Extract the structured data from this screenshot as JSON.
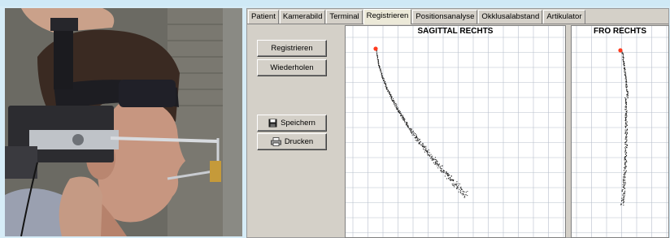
{
  "tabs": [
    {
      "label": "Patient",
      "active": false
    },
    {
      "label": "Kamerabild",
      "active": false
    },
    {
      "label": "Terminal",
      "active": false
    },
    {
      "label": "Registrieren",
      "active": true
    },
    {
      "label": "Positionsanalyse",
      "active": false
    },
    {
      "label": "Okklusalabstand",
      "active": false
    },
    {
      "label": "Artikulator",
      "active": false
    }
  ],
  "buttons": {
    "register": "Registrieren",
    "repeat": "Wiederholen",
    "save": "Speichern",
    "print": "Drucken",
    "save_icon": "floppy-disk-icon",
    "print_icon": "printer-icon"
  },
  "plots": {
    "sagittal": {
      "title": "SAGITTAL RECHTS"
    },
    "frontal": {
      "title": "FRO RECHTS"
    }
  },
  "colors": {
    "grid": "#b8bfcc",
    "trace": "#111111",
    "start_marker": "#ff3b1f",
    "panel": "#d4d0c8",
    "active_tab": "#ece9d8"
  },
  "photo": {
    "description_icon": "patient-with-facebow-photo"
  }
}
